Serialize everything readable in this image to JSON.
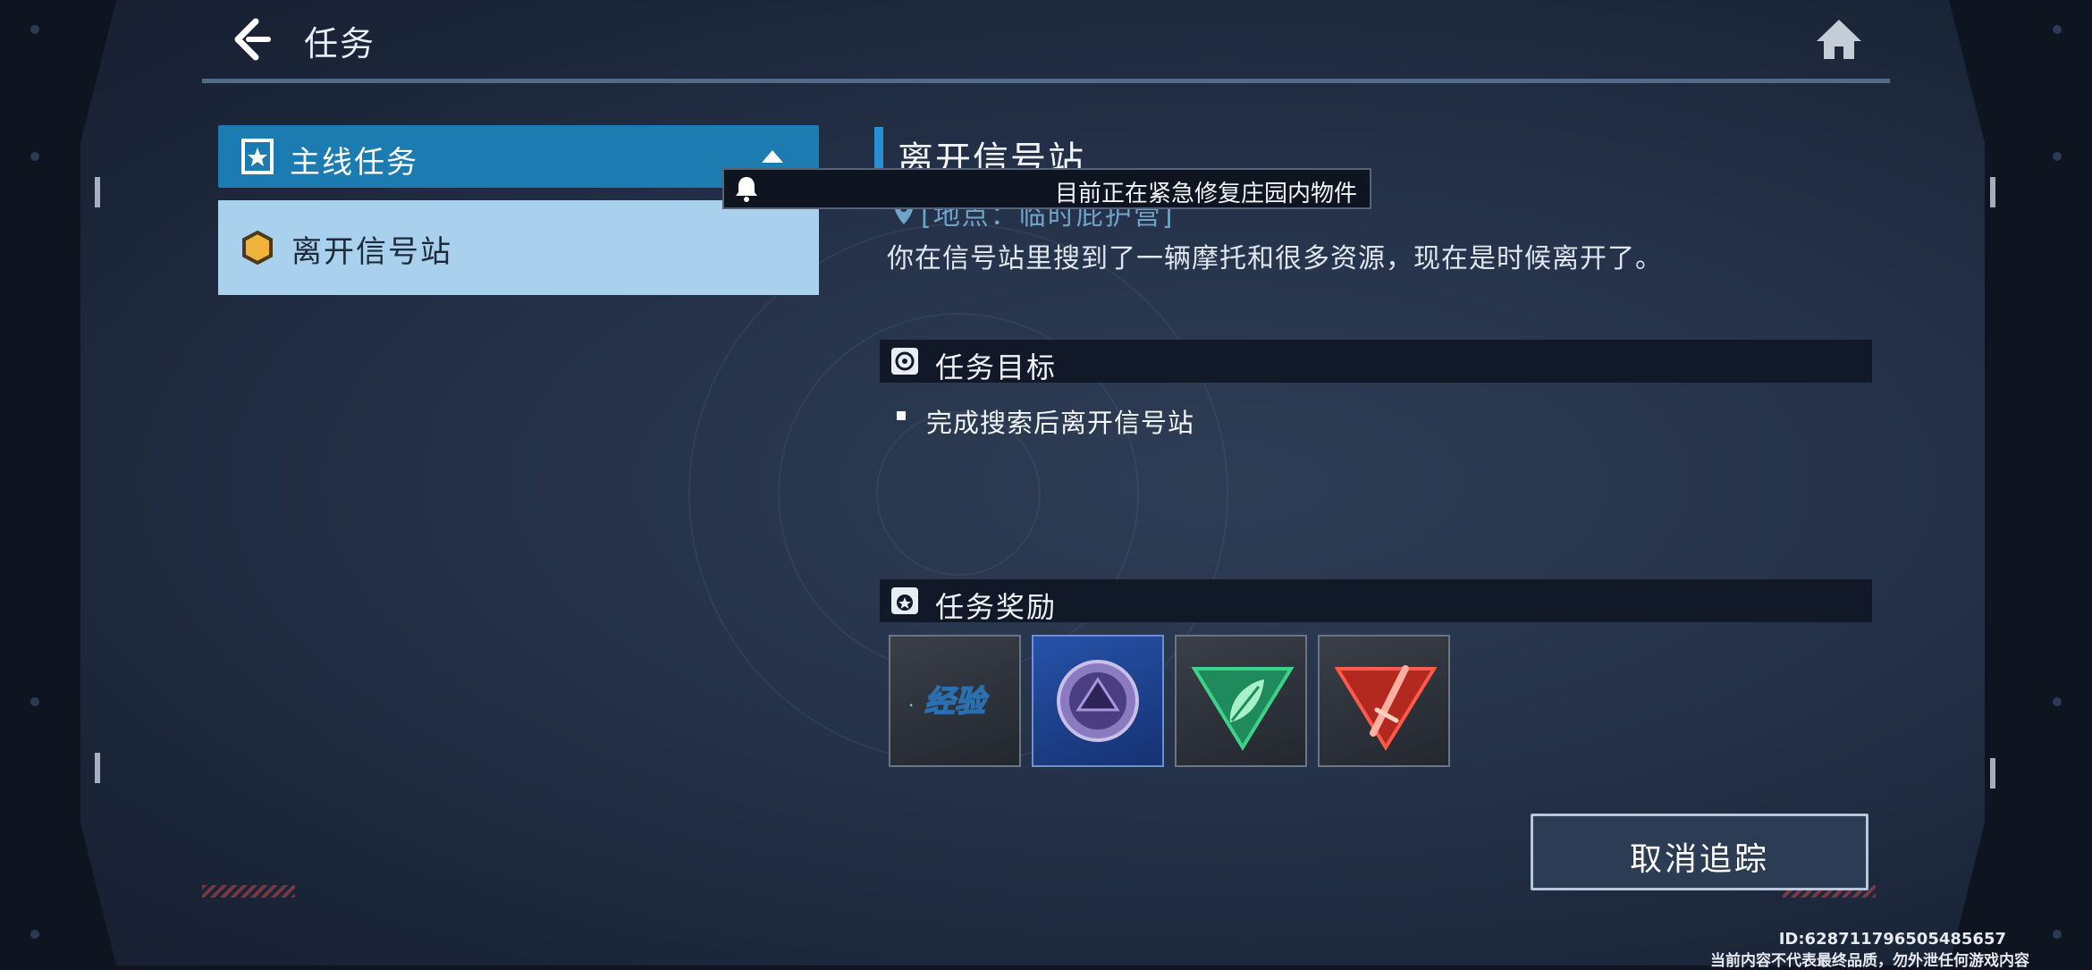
{
  "header": {
    "title": "任务"
  },
  "quest_list": {
    "category_label": "主线任务",
    "items": [
      {
        "label": "离开信号站"
      }
    ]
  },
  "notification": {
    "text": "目前正在紧急修复庄园内物件"
  },
  "detail": {
    "title": "离开信号站",
    "location": "[地点：临时庇护营]",
    "description": "你在信号站里搜到了一辆摩托和很多资源，现在是时候离开了。"
  },
  "objectives": {
    "section_label": "任务目标",
    "items": [
      "完成搜索后离开信号站"
    ]
  },
  "rewards": {
    "section_label": "任务奖励",
    "items": [
      {
        "icon": "exp-icon",
        "text": "经验"
      },
      {
        "icon": "purple-coin-icon",
        "selected": true
      },
      {
        "icon": "green-leaf-triangle-icon"
      },
      {
        "icon": "red-sword-triangle-icon"
      }
    ]
  },
  "actions": {
    "cancel_tracking_label": "取消追踪"
  },
  "watermark": {
    "id": "ID:628711796505485657",
    "note": "当前内容不代表最终品质，勿外泄任何游戏内容"
  },
  "colors": {
    "accent": "#1c7bb0",
    "selected_item_bg": "#a9d1ee",
    "location_text": "#6fa3c8",
    "section_bar": "#111827"
  }
}
